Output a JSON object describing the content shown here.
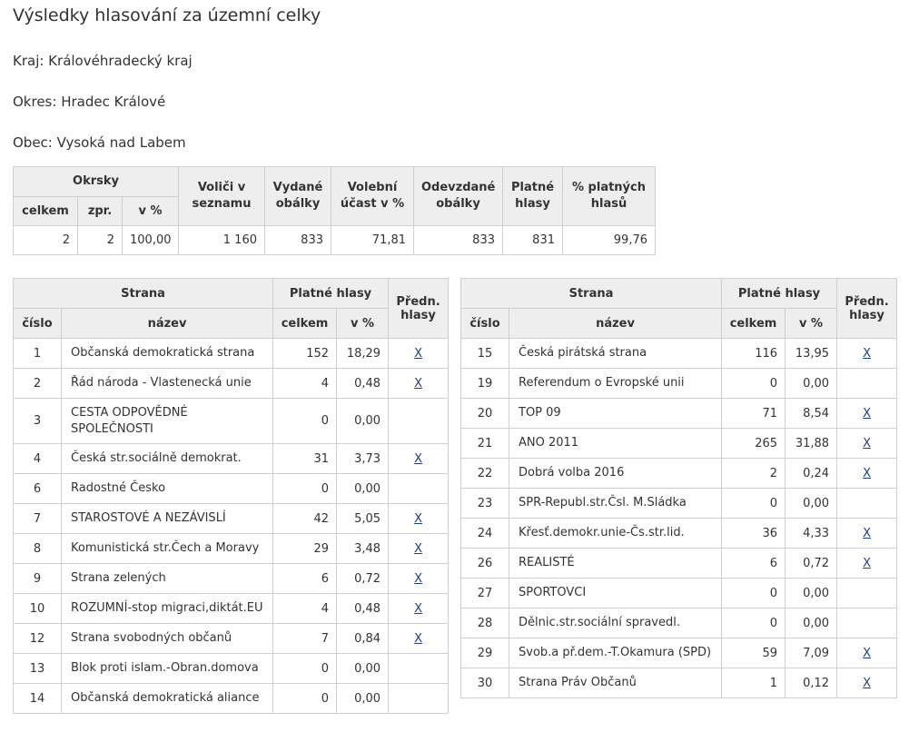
{
  "title": "Výsledky hlasování za územní celky",
  "region": "Kraj: Královéhradecký kraj",
  "district": "Okres: Hradec Králové",
  "municipality": "Obec: Vysoká nad Labem",
  "summary": {
    "headers": {
      "okrsky": "Okrsky",
      "celkem": "celkem",
      "zpr": "zpr.",
      "v_pct": "v %",
      "volici": "Voliči v seznamu",
      "vydane": "Vydané obálky",
      "ucast": "Volební účast v %",
      "odevzdane": "Odevzdané obálky",
      "platne": "Platné hlasy",
      "pct_platnych": "% platných hlasů"
    },
    "values": {
      "celkem": "2",
      "zpr": "2",
      "v_pct": "100,00",
      "volici": "1 160",
      "vydane": "833",
      "ucast": "71,81",
      "odevzdane": "833",
      "platne": "831",
      "pct_platnych": "99,76"
    }
  },
  "party_headers": {
    "strana": "Strana",
    "platne_hlasy": "Platné hlasy",
    "predn_hlasy": "Předn. hlasy",
    "cislo": "číslo",
    "nazev": "název",
    "celkem": "celkem",
    "v_pct": "v %"
  },
  "parties_left": [
    {
      "cislo": "1",
      "nazev": "Občanská demokratická strana",
      "celkem": "152",
      "pct": "18,29",
      "pref": "X"
    },
    {
      "cislo": "2",
      "nazev": "Řád národa - Vlastenecká unie",
      "celkem": "4",
      "pct": "0,48",
      "pref": "X"
    },
    {
      "cislo": "3",
      "nazev": "CESTA ODPOVĚDNÉ SPOLEČNOSTI",
      "celkem": "0",
      "pct": "0,00",
      "pref": ""
    },
    {
      "cislo": "4",
      "nazev": "Česká str.sociálně demokrat.",
      "celkem": "31",
      "pct": "3,73",
      "pref": "X"
    },
    {
      "cislo": "6",
      "nazev": "Radostné Česko",
      "celkem": "0",
      "pct": "0,00",
      "pref": ""
    },
    {
      "cislo": "7",
      "nazev": "STAROSTOVÉ A NEZÁVISLÍ",
      "celkem": "42",
      "pct": "5,05",
      "pref": "X"
    },
    {
      "cislo": "8",
      "nazev": "Komunistická str.Čech a Moravy",
      "celkem": "29",
      "pct": "3,48",
      "pref": "X"
    },
    {
      "cislo": "9",
      "nazev": "Strana zelených",
      "celkem": "6",
      "pct": "0,72",
      "pref": "X"
    },
    {
      "cislo": "10",
      "nazev": "ROZUMNÍ-stop migraci,diktát.EU",
      "celkem": "4",
      "pct": "0,48",
      "pref": "X"
    },
    {
      "cislo": "12",
      "nazev": "Strana svobodných občanů",
      "celkem": "7",
      "pct": "0,84",
      "pref": "X"
    },
    {
      "cislo": "13",
      "nazev": "Blok proti islam.-Obran.domova",
      "celkem": "0",
      "pct": "0,00",
      "pref": ""
    },
    {
      "cislo": "14",
      "nazev": "Občanská demokratická aliance",
      "celkem": "0",
      "pct": "0,00",
      "pref": ""
    }
  ],
  "parties_right": [
    {
      "cislo": "15",
      "nazev": "Česká pirátská strana",
      "celkem": "116",
      "pct": "13,95",
      "pref": "X"
    },
    {
      "cislo": "19",
      "nazev": "Referendum o Evropské unii",
      "celkem": "0",
      "pct": "0,00",
      "pref": ""
    },
    {
      "cislo": "20",
      "nazev": "TOP 09",
      "celkem": "71",
      "pct": "8,54",
      "pref": "X"
    },
    {
      "cislo": "21",
      "nazev": "ANO 2011",
      "celkem": "265",
      "pct": "31,88",
      "pref": "X"
    },
    {
      "cislo": "22",
      "nazev": "Dobrá volba 2016",
      "celkem": "2",
      "pct": "0,24",
      "pref": "X"
    },
    {
      "cislo": "23",
      "nazev": "SPR-Republ.str.Čsl. M.Sládka",
      "celkem": "0",
      "pct": "0,00",
      "pref": ""
    },
    {
      "cislo": "24",
      "nazev": "Křesť.demokr.unie-Čs.str.lid.",
      "celkem": "36",
      "pct": "4,33",
      "pref": "X"
    },
    {
      "cislo": "26",
      "nazev": "REALISTÉ",
      "celkem": "6",
      "pct": "0,72",
      "pref": "X"
    },
    {
      "cislo": "27",
      "nazev": "SPORTOVCI",
      "celkem": "0",
      "pct": "0,00",
      "pref": ""
    },
    {
      "cislo": "28",
      "nazev": "Dělnic.str.sociální spravedl.",
      "celkem": "0",
      "pct": "0,00",
      "pref": ""
    },
    {
      "cislo": "29",
      "nazev": "Svob.a př.dem.-T.Okamura (SPD)",
      "celkem": "59",
      "pct": "7,09",
      "pref": "X"
    },
    {
      "cislo": "30",
      "nazev": "Strana Práv Občanů",
      "celkem": "1",
      "pct": "0,12",
      "pref": "X"
    }
  ]
}
